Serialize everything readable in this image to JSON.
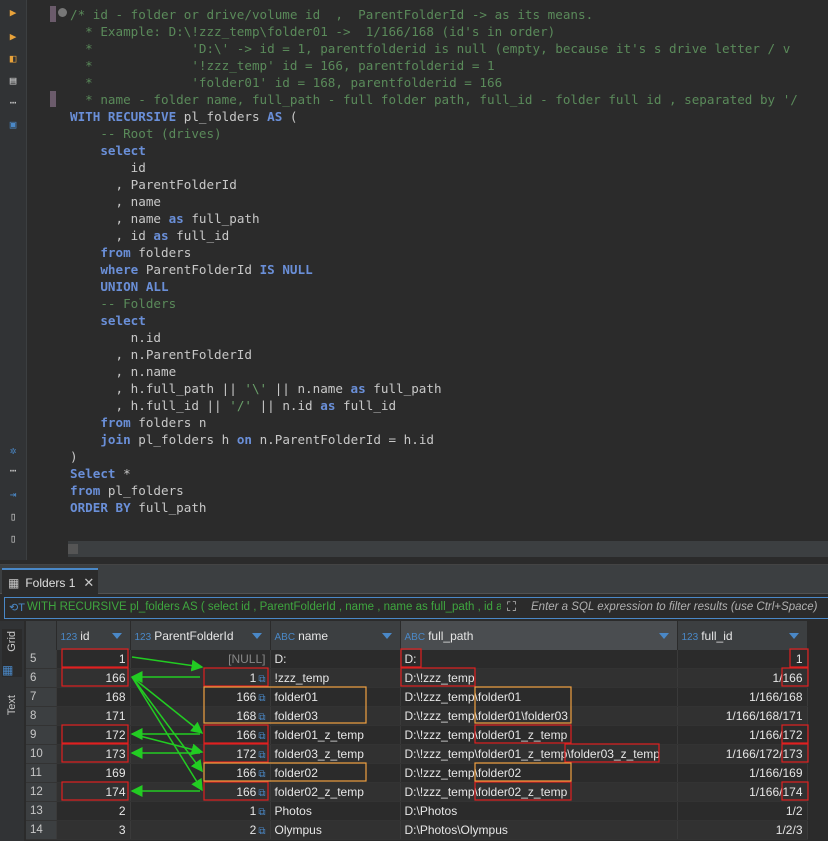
{
  "editor": {
    "code_lines": [
      [
        {
          "t": "/* id - folder or drive/volume id  ,  ParentFolderId -> as its means.",
          "c": "cm"
        }
      ],
      [
        {
          "t": "  * Example: D:\\!zzz_temp\\folder01 ->  1/166/168 (id's in order)",
          "c": "cm"
        }
      ],
      [
        {
          "t": "  *             'D:\\' -> id = 1, parentfolderid is null (empty, because it's s drive letter / v",
          "c": "cm"
        }
      ],
      [
        {
          "t": "  *             '!zzz_temp' id = 166, parentfolderid = 1",
          "c": "cm"
        }
      ],
      [
        {
          "t": "  *             'folder01' id = 168, parentfolderid = 166",
          "c": "cm"
        }
      ],
      [
        {
          "t": "  * name - folder name, full_path - full folder path, full_id - folder full id , separated by '/",
          "c": "cm"
        }
      ],
      [
        {
          "t": "WITH RECURSIVE",
          "c": "kw"
        },
        {
          "t": " pl_folders ",
          "c": "op"
        },
        {
          "t": "AS",
          "c": "kw"
        },
        {
          "t": " (",
          "c": "op"
        }
      ],
      [
        {
          "t": "    -- Root (drives)",
          "c": "cm"
        }
      ],
      [
        {
          "t": "    ",
          "c": "op"
        },
        {
          "t": "select",
          "c": "kw"
        }
      ],
      [
        {
          "t": "        id",
          "c": "op"
        }
      ],
      [
        {
          "t": "      , ParentFolderId",
          "c": "op"
        }
      ],
      [
        {
          "t": "      , name",
          "c": "op"
        }
      ],
      [
        {
          "t": "      , name ",
          "c": "op"
        },
        {
          "t": "as",
          "c": "kw"
        },
        {
          "t": " full_path",
          "c": "op"
        }
      ],
      [
        {
          "t": "      , id ",
          "c": "op"
        },
        {
          "t": "as",
          "c": "kw"
        },
        {
          "t": " full_id",
          "c": "op"
        }
      ],
      [
        {
          "t": "    ",
          "c": "op"
        },
        {
          "t": "from",
          "c": "kw"
        },
        {
          "t": " folders",
          "c": "op"
        }
      ],
      [
        {
          "t": "    ",
          "c": "op"
        },
        {
          "t": "where",
          "c": "kw"
        },
        {
          "t": " ParentFolderId ",
          "c": "op"
        },
        {
          "t": "IS NULL",
          "c": "kw"
        }
      ],
      [
        {
          "t": "    ",
          "c": "op"
        },
        {
          "t": "UNION ALL",
          "c": "kw"
        }
      ],
      [
        {
          "t": "    -- Folders",
          "c": "cm"
        }
      ],
      [
        {
          "t": "    ",
          "c": "op"
        },
        {
          "t": "select",
          "c": "kw"
        }
      ],
      [
        {
          "t": "        n.id",
          "c": "op"
        }
      ],
      [
        {
          "t": "      , n.ParentFolderId",
          "c": "op"
        }
      ],
      [
        {
          "t": "      , n.name",
          "c": "op"
        }
      ],
      [
        {
          "t": "      , h.full_path || ",
          "c": "op"
        },
        {
          "t": "'\\'",
          "c": "st"
        },
        {
          "t": " || n.name ",
          "c": "op"
        },
        {
          "t": "as",
          "c": "kw"
        },
        {
          "t": " full_path",
          "c": "op"
        }
      ],
      [
        {
          "t": "      , h.full_id || ",
          "c": "op"
        },
        {
          "t": "'/'",
          "c": "st"
        },
        {
          "t": " || n.id ",
          "c": "op"
        },
        {
          "t": "as",
          "c": "kw"
        },
        {
          "t": " full_id",
          "c": "op"
        }
      ],
      [
        {
          "t": "    ",
          "c": "op"
        },
        {
          "t": "from",
          "c": "kw"
        },
        {
          "t": " folders n",
          "c": "op"
        }
      ],
      [
        {
          "t": "    ",
          "c": "op"
        },
        {
          "t": "join",
          "c": "kw"
        },
        {
          "t": " pl_folders h ",
          "c": "op"
        },
        {
          "t": "on",
          "c": "kw"
        },
        {
          "t": " n.ParentFolderId = h.id",
          "c": "op"
        }
      ],
      [
        {
          "t": ")",
          "c": "op"
        }
      ],
      [
        {
          "t": "Select",
          "c": "kw"
        },
        {
          "t": " *",
          "c": "op"
        }
      ],
      [
        {
          "t": "from",
          "c": "kw"
        },
        {
          "t": " pl_folders",
          "c": "op"
        }
      ],
      [
        {
          "t": "ORDER BY",
          "c": "kw"
        },
        {
          "t": " full_path",
          "c": "op"
        }
      ]
    ]
  },
  "results": {
    "tab_label": "Folders 1",
    "filter_query": "WITH RECURSIVE pl_folders AS ( select id , ParentFolderId , name , name as full_path , id as",
    "filter_placeholder": "Enter a SQL expression to filter results (use Ctrl+Space)",
    "side_tabs": {
      "grid": "Grid",
      "text": "Text"
    },
    "columns": [
      {
        "type": "123",
        "name": "id"
      },
      {
        "type": "123",
        "name": "ParentFolderId"
      },
      {
        "type": "ABC",
        "name": "name"
      },
      {
        "type": "ABC",
        "name": "full_path"
      },
      {
        "type": "123",
        "name": "full_id"
      }
    ],
    "rows": [
      {
        "rn": "5",
        "id": "1",
        "pid": "[NULL]",
        "name": "D:",
        "path": "D:",
        "fid": "1"
      },
      {
        "rn": "6",
        "id": "166",
        "pid": "1",
        "name": "!zzz_temp",
        "path": "D:\\!zzz_temp",
        "fid": "1/166"
      },
      {
        "rn": "7",
        "id": "168",
        "pid": "166",
        "name": "folder01",
        "path": "D:\\!zzz_temp\\folder01",
        "fid": "1/166/168"
      },
      {
        "rn": "8",
        "id": "171",
        "pid": "168",
        "name": "folder03",
        "path": "D:\\!zzz_temp\\folder01\\folder03",
        "fid": "1/166/168/171"
      },
      {
        "rn": "9",
        "id": "172",
        "pid": "166",
        "name": "folder01_z_temp",
        "path": "D:\\!zzz_temp\\folder01_z_temp",
        "fid": "1/166/172"
      },
      {
        "rn": "10",
        "id": "173",
        "pid": "172",
        "name": "folder03_z_temp",
        "path": "D:\\!zzz_temp\\folder01_z_temp\\folder03_z_temp",
        "fid": "1/166/172/173"
      },
      {
        "rn": "11",
        "id": "169",
        "pid": "166",
        "name": "folder02",
        "path": "D:\\!zzz_temp\\folder02",
        "fid": "1/166/169"
      },
      {
        "rn": "12",
        "id": "174",
        "pid": "166",
        "name": "folder02_z_temp",
        "path": "D:\\!zzz_temp\\folder02_z_temp",
        "fid": "1/166/174"
      },
      {
        "rn": "13",
        "id": "2",
        "pid": "1",
        "name": "Photos",
        "path": "D:\\Photos",
        "fid": "1/2"
      },
      {
        "rn": "14",
        "id": "3",
        "pid": "2",
        "name": "Olympus",
        "path": "D:\\Photos\\Olympus",
        "fid": "1/2/3"
      }
    ]
  },
  "colors": {
    "accent": "#4a88c7",
    "annotation_red": "#e02020",
    "annotation_orange": "#f0a040",
    "annotation_green": "#22cc22"
  }
}
